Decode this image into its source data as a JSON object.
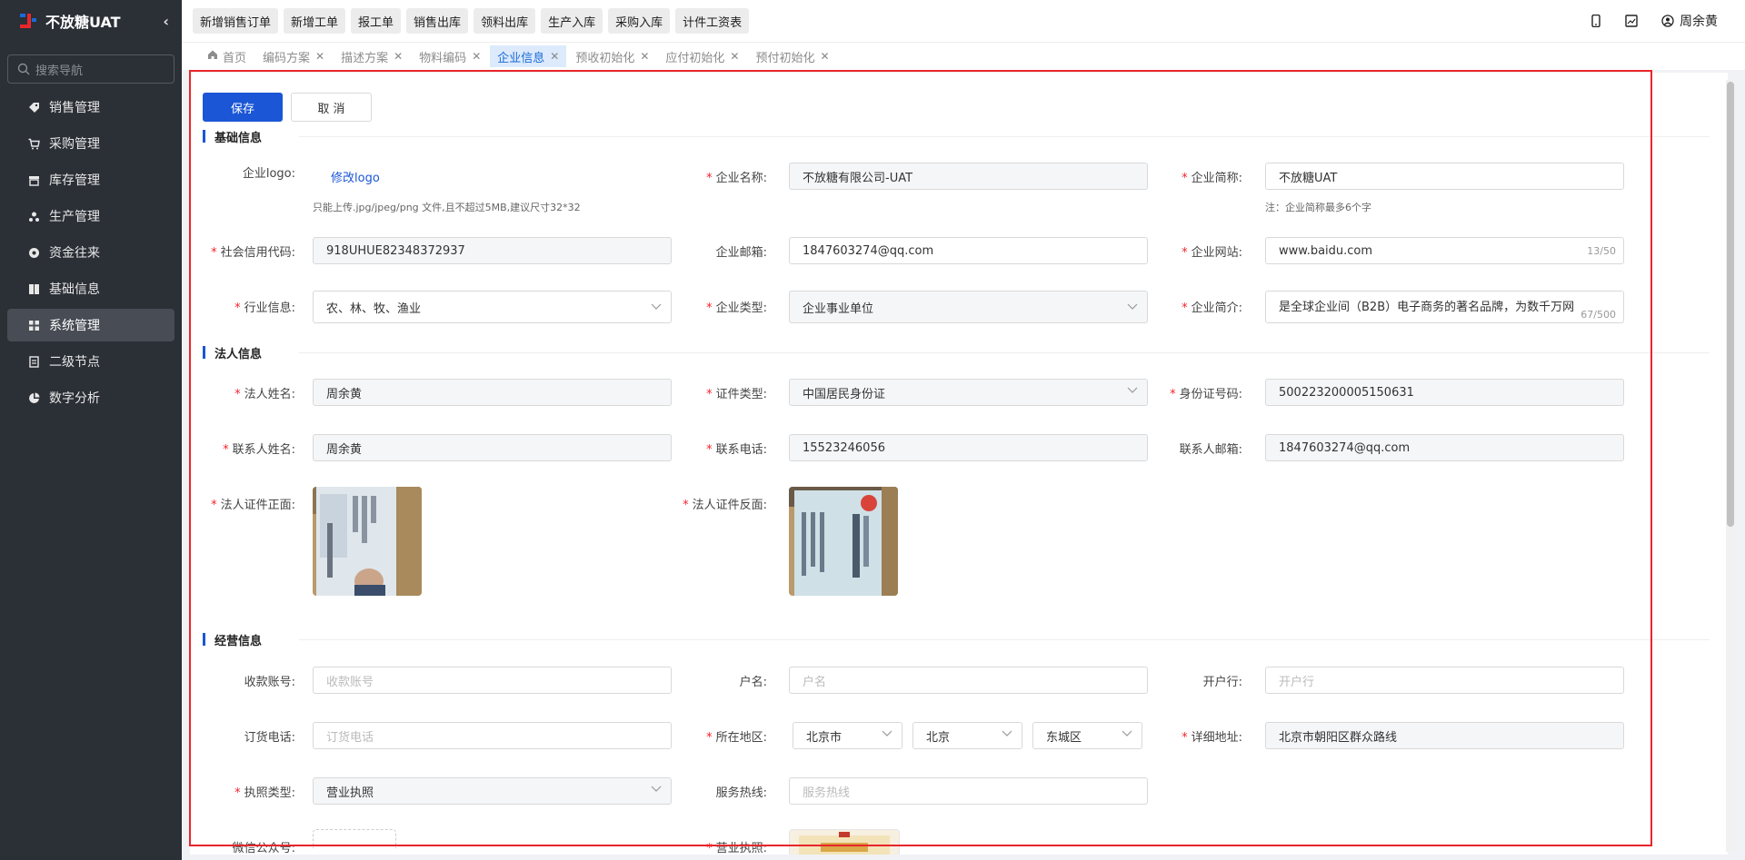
{
  "app": {
    "title": "不放糖UAT"
  },
  "sidebar": {
    "search_placeholder": "搜索导航",
    "items": [
      {
        "label": "销售管理",
        "icon": "tag-icon"
      },
      {
        "label": "采购管理",
        "icon": "cart-icon"
      },
      {
        "label": "库存管理",
        "icon": "warehouse-icon"
      },
      {
        "label": "生产管理",
        "icon": "production-icon"
      },
      {
        "label": "资金往来",
        "icon": "money-icon"
      },
      {
        "label": "基础信息",
        "icon": "book-icon"
      },
      {
        "label": "系统管理",
        "icon": "grid-icon",
        "active": true
      },
      {
        "label": "二级节点",
        "icon": "doc-icon"
      },
      {
        "label": "数字分析",
        "icon": "pie-icon"
      }
    ]
  },
  "quick_actions": [
    "新增销售订单",
    "新增工单",
    "报工单",
    "销售出库",
    "领料出库",
    "生产入库",
    "采购入库",
    "计件工资表"
  ],
  "topbar": {
    "user_name": "周余黄"
  },
  "tabs": [
    {
      "label": "首页",
      "closable": false
    },
    {
      "label": "编码方案",
      "closable": true
    },
    {
      "label": "描述方案",
      "closable": true
    },
    {
      "label": "物料编码",
      "closable": true
    },
    {
      "label": "企业信息",
      "closable": true,
      "active": true
    },
    {
      "label": "预收初始化",
      "closable": true
    },
    {
      "label": "应付初始化",
      "closable": true
    },
    {
      "label": "预付初始化",
      "closable": true
    }
  ],
  "actions": {
    "save": "保存",
    "cancel": "取 消"
  },
  "basic": {
    "title": "基础信息",
    "logo_label": "企业logo:",
    "logo_link": "修改logo",
    "logo_help": "只能上传.jpg/jpeg/png 文件,且不超过5MB,建议尺寸32*32",
    "name_label": "企业名称:",
    "name_value": "不放糖有限公司-UAT",
    "short_label": "企业简称:",
    "short_value": "不放糖UAT",
    "short_help": "注：企业简称最多6个字",
    "credit_label": "社会信用代码:",
    "credit_value": "918UHUE82348372937",
    "email_label": "企业邮箱:",
    "email_value": "1847603274@qq.com",
    "website_label": "企业网站:",
    "website_value": "www.baidu.com",
    "website_count": "13/50",
    "industry_label": "行业信息:",
    "industry_value": "农、林、牧、渔业",
    "type_label": "企业类型:",
    "type_value": "企业事业单位",
    "intro_label": "企业简介:",
    "intro_value": "是全球企业间（B2B）电子商务的著名品牌，为数千万网",
    "intro_count": "67/500"
  },
  "legal": {
    "title": "法人信息",
    "name_label": "法人姓名:",
    "name_value": "周余黄",
    "idtype_label": "证件类型:",
    "idtype_value": "中国居民身份证",
    "idno_label": "身份证号码:",
    "idno_value": "500223200005150631",
    "contact_label": "联系人姓名:",
    "contact_value": "周余黄",
    "phone_label": "联系电话:",
    "phone_value": "15523246056",
    "cemail_label": "联系人邮箱:",
    "cemail_value": "1847603274@qq.com",
    "front_label": "法人证件正面:",
    "back_label": "法人证件反面:"
  },
  "business": {
    "title": "经营信息",
    "account_label": "收款账号:",
    "account_ph": "收款账号",
    "holder_label": "户名:",
    "holder_ph": "户名",
    "bank_label": "开户行:",
    "bank_ph": "开户行",
    "orderphone_label": "订货电话:",
    "orderphone_ph": "订货电话",
    "region_label": "所在地区:",
    "province": "北京市",
    "city": "北京",
    "district": "东城区",
    "address_label": "详细地址:",
    "address_value": "北京市朝阳区群众路线",
    "license_type_label": "执照类型:",
    "license_type_value": "营业执照",
    "hotline_label": "服务热线:",
    "hotline_ph": "服务热线",
    "wechat_label": "微信公众号:",
    "license_label": "营业执照:"
  },
  "colors": {
    "accent": "#1a56d6",
    "required": "#f5222d",
    "highlight": "#e8262b",
    "sidebar": "#2b2f36"
  }
}
